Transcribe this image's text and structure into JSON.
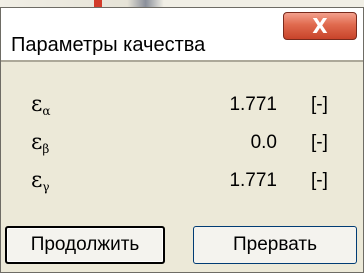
{
  "dialog": {
    "title": "Параметры качества",
    "close_symbol": "X"
  },
  "params": [
    {
      "symbol": "ε",
      "subscript": "α",
      "value": "1.771",
      "unit": "[-]"
    },
    {
      "symbol": "ε",
      "subscript": "β",
      "value": "0.0",
      "unit": "[-]"
    },
    {
      "symbol": "ε",
      "subscript": "γ",
      "value": "1.771",
      "unit": "[-]"
    }
  ],
  "buttons": {
    "continue_label": "Продолжить",
    "abort_label": "Прервать"
  }
}
